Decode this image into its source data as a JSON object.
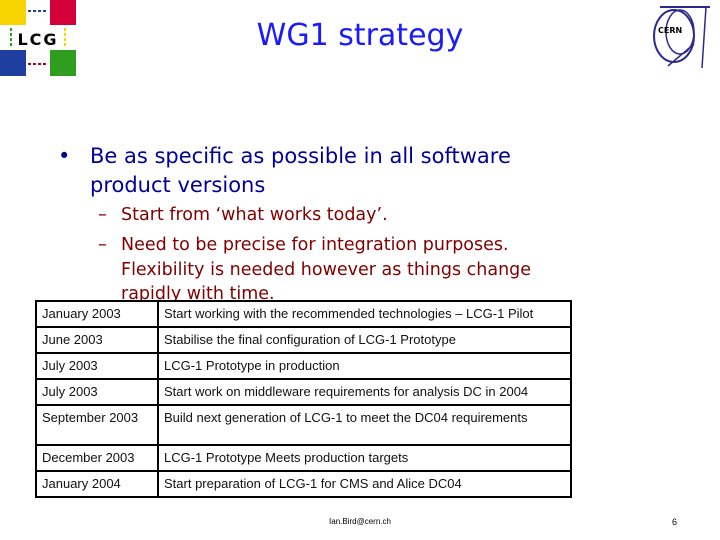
{
  "logo_left": {
    "text": "LCG",
    "colors": [
      "#f7d300",
      "#d4003a",
      "#1f3fa0",
      "#2f9e1f"
    ]
  },
  "logo_right": {
    "text": "CERN",
    "color": "#2a2a90"
  },
  "title": "WG1 strategy",
  "bullet": {
    "text": "Be as specific as possible in all software product versions",
    "subs": [
      "Start from ‘what works today’.",
      "Need to be precise for integration purposes. Flexibility is needed however as things change rapidly with time."
    ]
  },
  "table": {
    "rows": [
      [
        "January 2003",
        "Start working with the recommended technologies – LCG-1 Pilot"
      ],
      [
        "June 2003",
        "Stabilise the final configuration of LCG-1 Prototype"
      ],
      [
        "July 2003",
        "LCG-1 Prototype in production"
      ],
      [
        "July 2003",
        "Start work on middleware requirements for analysis DC in 2004"
      ],
      [
        "September 2003",
        "Build next generation of LCG-1 to meet the DC04 requirements"
      ],
      [
        "December 2003",
        "LCG-1 Prototype Meets production targets"
      ],
      [
        "January 2004",
        "Start preparation of LCG-1 for CMS and Alice DC04"
      ]
    ]
  },
  "footer": "Ian.Bird@cern.ch",
  "page_number": "6"
}
